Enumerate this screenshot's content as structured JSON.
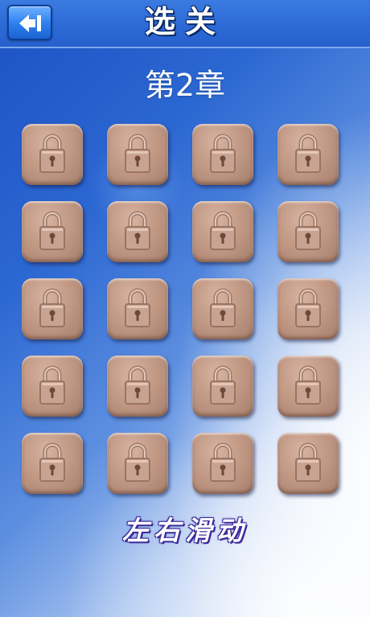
{
  "header": {
    "title": "选关",
    "back_icon": "back-arrow-icon"
  },
  "chapter": {
    "title": "第2章"
  },
  "levels": {
    "rows": 5,
    "columns": 4,
    "items": [
      {
        "state": "locked",
        "icon": "lock-icon"
      },
      {
        "state": "locked",
        "icon": "lock-icon"
      },
      {
        "state": "locked",
        "icon": "lock-icon"
      },
      {
        "state": "locked",
        "icon": "lock-icon"
      },
      {
        "state": "locked",
        "icon": "lock-icon"
      },
      {
        "state": "locked",
        "icon": "lock-icon"
      },
      {
        "state": "locked",
        "icon": "lock-icon"
      },
      {
        "state": "locked",
        "icon": "lock-icon"
      },
      {
        "state": "locked",
        "icon": "lock-icon"
      },
      {
        "state": "locked",
        "icon": "lock-icon"
      },
      {
        "state": "locked",
        "icon": "lock-icon"
      },
      {
        "state": "locked",
        "icon": "lock-icon"
      },
      {
        "state": "locked",
        "icon": "lock-icon"
      },
      {
        "state": "locked",
        "icon": "lock-icon"
      },
      {
        "state": "locked",
        "icon": "lock-icon"
      },
      {
        "state": "locked",
        "icon": "lock-icon"
      },
      {
        "state": "locked",
        "icon": "lock-icon"
      },
      {
        "state": "locked",
        "icon": "lock-icon"
      },
      {
        "state": "locked",
        "icon": "lock-icon"
      },
      {
        "state": "locked",
        "icon": "lock-icon"
      }
    ]
  },
  "footer": {
    "hint": "左右滑动"
  },
  "colors": {
    "background_blue": "#2a63c8",
    "tile_brown": "#c29a86",
    "hint_outline": "#3b2a9a"
  }
}
